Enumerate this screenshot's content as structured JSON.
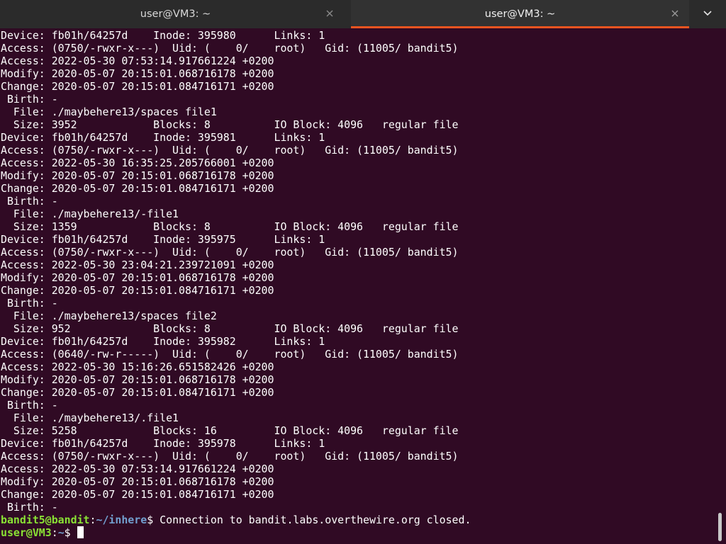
{
  "tabs": [
    {
      "title": "user@VM3: ~",
      "active": false
    },
    {
      "title": "user@VM3: ~",
      "active": true
    }
  ],
  "colors": {
    "background": "#300a24",
    "tabbar": "#2b2b2b",
    "accent": "#e95420",
    "prompt_user": "#8ae234",
    "prompt_path": "#729fcf"
  },
  "terminal": {
    "lines": [
      "Device: fb01h/64257d    Inode: 395980      Links: 1",
      "Access: (0750/-rwxr-x---)  Uid: (    0/    root)   Gid: (11005/ bandit5)",
      "Access: 2022-05-30 07:53:14.917661224 +0200",
      "Modify: 2020-05-07 20:15:01.068716178 +0200",
      "Change: 2020-05-07 20:15:01.084716171 +0200",
      " Birth: -",
      "  File: ./maybehere13/spaces file1",
      "  Size: 3952            Blocks: 8          IO Block: 4096   regular file",
      "Device: fb01h/64257d    Inode: 395981      Links: 1",
      "Access: (0750/-rwxr-x---)  Uid: (    0/    root)   Gid: (11005/ bandit5)",
      "Access: 2022-05-30 16:35:25.205766001 +0200",
      "Modify: 2020-05-07 20:15:01.068716178 +0200",
      "Change: 2020-05-07 20:15:01.084716171 +0200",
      " Birth: -",
      "  File: ./maybehere13/-file1",
      "  Size: 1359            Blocks: 8          IO Block: 4096   regular file",
      "Device: fb01h/64257d    Inode: 395975      Links: 1",
      "Access: (0750/-rwxr-x---)  Uid: (    0/    root)   Gid: (11005/ bandit5)",
      "Access: 2022-05-30 23:04:21.239721091 +0200",
      "Modify: 2020-05-07 20:15:01.068716178 +0200",
      "Change: 2020-05-07 20:15:01.084716171 +0200",
      " Birth: -",
      "  File: ./maybehere13/spaces file2",
      "  Size: 952             Blocks: 8          IO Block: 4096   regular file",
      "Device: fb01h/64257d    Inode: 395982      Links: 1",
      "Access: (0640/-rw-r-----)  Uid: (    0/    root)   Gid: (11005/ bandit5)",
      "Access: 2022-05-30 15:16:26.651582426 +0200",
      "Modify: 2020-05-07 20:15:01.068716178 +0200",
      "Change: 2020-05-07 20:15:01.084716171 +0200",
      " Birth: -",
      "  File: ./maybehere13/.file1",
      "  Size: 5258            Blocks: 16         IO Block: 4096   regular file",
      "Device: fb01h/64257d    Inode: 395978      Links: 1",
      "Access: (0750/-rwxr-x---)  Uid: (    0/    root)   Gid: (11005/ bandit5)",
      "Access: 2022-05-30 07:53:14.917661224 +0200",
      "Modify: 2020-05-07 20:15:01.068716178 +0200",
      "Change: 2020-05-07 20:15:01.084716171 +0200",
      " Birth: -"
    ],
    "remote_prompt": {
      "userhost": "bandit5@bandit",
      "sep": ":",
      "path": "~/inhere",
      "symbol": "$ ",
      "text": "Connection to bandit.labs.overthewire.org closed."
    },
    "local_prompt": {
      "userhost": "user@VM3",
      "sep": ":",
      "path": "~",
      "symbol": "$ "
    }
  }
}
